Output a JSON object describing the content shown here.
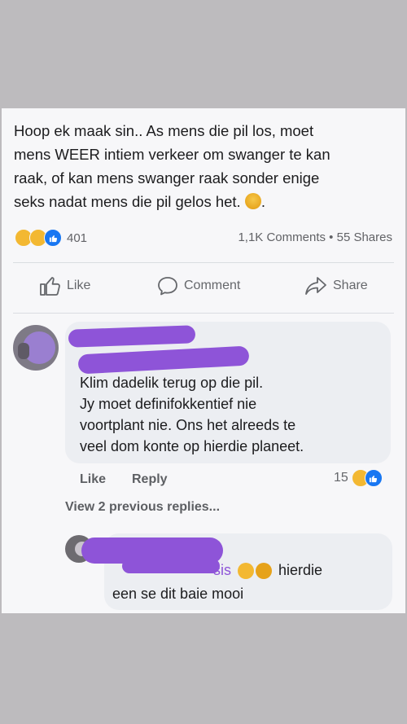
{
  "post": {
    "text_lines": [
      "Hoop ek maak sin.. As mens die pil los, moet",
      "mens WEER intiem verkeer om swanger te kan",
      "raak, of kan mens swanger raak sonder enige",
      "seks nadat mens die pil gelos het."
    ],
    "trailing_emoji": "worried-face-icon",
    "text_end": "."
  },
  "stats": {
    "reaction_count": "401",
    "comments": "1,1K Comments",
    "separator": "•",
    "shares": "55 Shares"
  },
  "actions": {
    "like": "Like",
    "comment": "Comment",
    "share": "Share"
  },
  "comment1": {
    "lines": [
      "Klim dadelik terug op die pil.",
      "Jy moet definifokkentief nie",
      "voortplant nie. Ons het alreeds te",
      "veel dom konte op hierdie planeet."
    ],
    "like": "Like",
    "reply": "Reply",
    "reaction_count": "15"
  },
  "view_previous": "View 2 previous replies...",
  "reply": {
    "name_tail": "sis",
    "line1_tail": "hierdie",
    "line2": "een se dit baie mooi"
  },
  "colors": {
    "redaction": "#8e54d8",
    "like_blue": "#1877f2",
    "haha_yellow": "#f3b832",
    "bubble": "#eceef2"
  }
}
